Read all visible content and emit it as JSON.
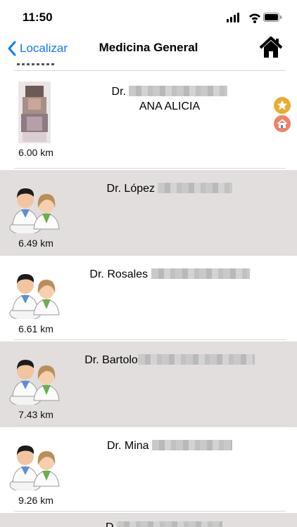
{
  "status": {
    "time": "11:50"
  },
  "nav": {
    "back_label": "Localizar",
    "title": "Medicina General"
  },
  "rows": [
    {
      "name_prefix": "Dr.",
      "name_second": "ANA ALICIA",
      "distance": "6.00 km"
    },
    {
      "name_prefix": "Dr. López",
      "distance": "6.49 km"
    },
    {
      "name_prefix": "Dr. Rosales",
      "distance": "6.61 km"
    },
    {
      "name_prefix": "Dr. Bartolo",
      "distance": "7.43 km"
    },
    {
      "name_prefix": "Dr. Mina",
      "distance": "9.26 km"
    },
    {
      "name_prefix": "D"
    }
  ],
  "colors": {
    "accent": "#1478f6",
    "alt_row": "#e2dede",
    "badge_star": "#e8ad2e",
    "badge_home": "#ee8467"
  },
  "icons": [
    "back-chevron-icon",
    "home-icon",
    "star-badge-icon",
    "house-badge-icon",
    "doctors-icon"
  ]
}
